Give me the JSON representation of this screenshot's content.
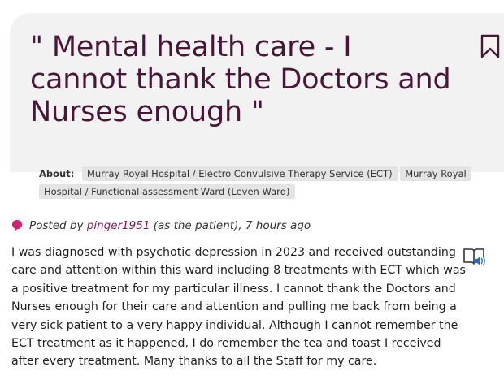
{
  "review": {
    "title": "\" Mental health care - I cannot thank the Doctors and Nurses enough \"",
    "about_label": "About:",
    "tags": [
      "Murray Royal Hospital / Electro Convulsive Therapy Service (ECT)",
      "Murray Royal Hospital / Functional assessment Ward (Leven Ward)"
    ],
    "posted_by_prefix": "Posted by",
    "author": "pinger1951",
    "posted_suffix": "(as the patient), 7 hours ago",
    "body": "I was diagnosed with psychotic depression in 2023 and received outstanding care and attention within this ward including 8 treatments with ECT which was a positive treatment for my particular illness. I cannot thank the Doctors and Nurses enough for their care and attention and pulling me back from being a very sick patient to a very happy individual. Although I cannot remember the ECT treatment as it happened, I do remember the tea and toast I received after every treatment. Many thanks to all the Staff for my care."
  },
  "icons": {
    "bookmark": "bookmark-icon",
    "comment": "speech-bubble-icon",
    "listen": "read-aloud-icon"
  },
  "colors": {
    "title": "#4a1637",
    "accent": "#d6206f",
    "author_link": "#8b1a55",
    "card_bg": "#f2f2f2",
    "tag_bg": "#e4e4e4"
  }
}
